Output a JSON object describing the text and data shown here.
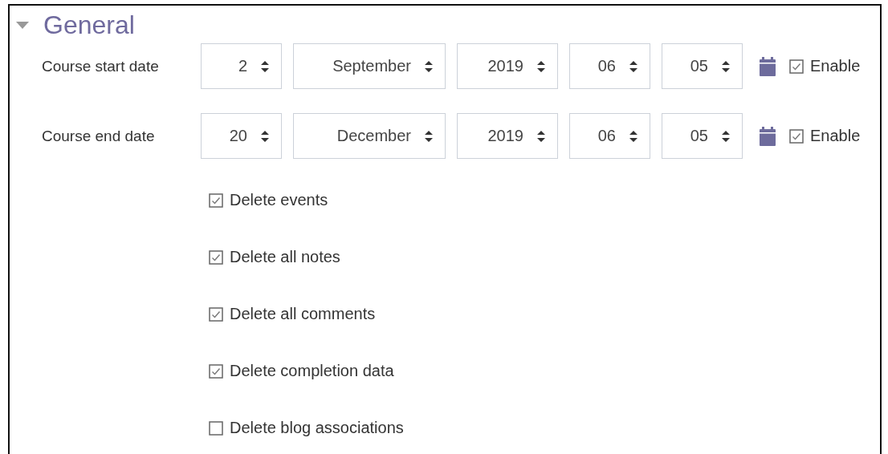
{
  "section": {
    "title": "General",
    "expanded": true
  },
  "date_rows": [
    {
      "label": "Course start date",
      "fields": [
        "2",
        "September",
        "2019",
        "06",
        "05"
      ],
      "enable": {
        "label": "Enable",
        "checked": true
      }
    },
    {
      "label": "Course end date",
      "fields": [
        "20",
        "December",
        "2019",
        "06",
        "05"
      ],
      "enable": {
        "label": "Enable",
        "checked": true
      }
    }
  ],
  "options": [
    {
      "label": "Delete events",
      "checked": true
    },
    {
      "label": "Delete all notes",
      "checked": true
    },
    {
      "label": "Delete all comments",
      "checked": true
    },
    {
      "label": "Delete completion data",
      "checked": true
    },
    {
      "label": "Delete blog associations",
      "checked": false
    }
  ]
}
